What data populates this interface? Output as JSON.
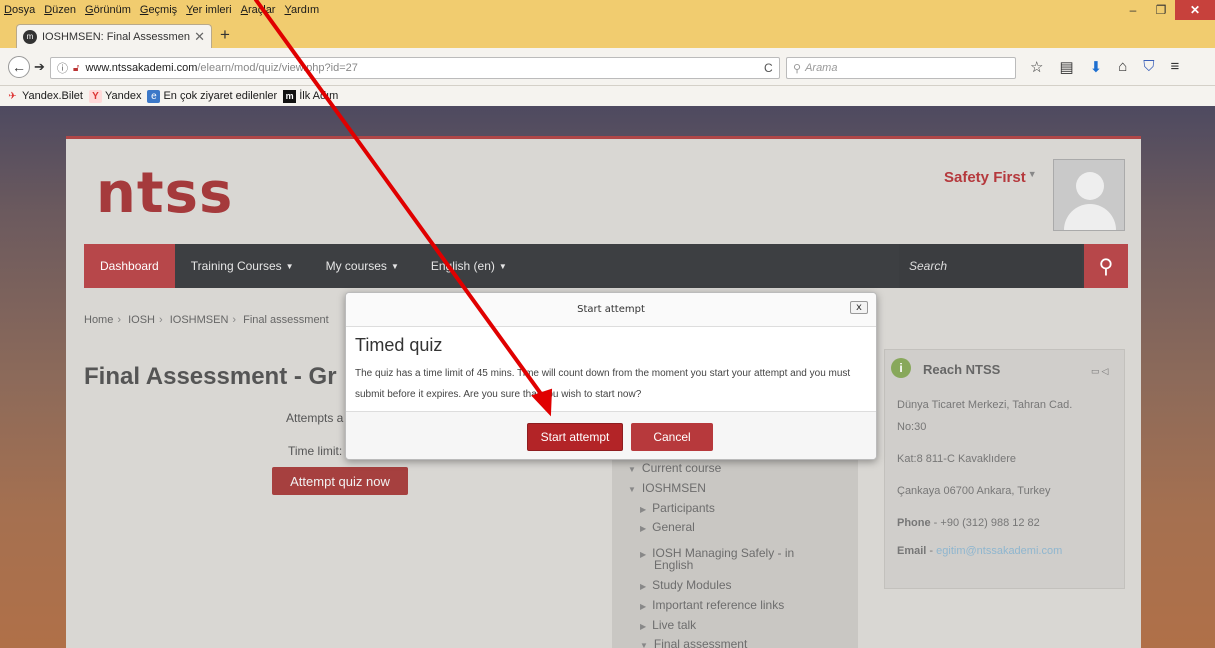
{
  "browser": {
    "menu": [
      "Dosya",
      "Düzen",
      "Görünüm",
      "Geçmiş",
      "Yer imleri",
      "Araçlar",
      "Yardım"
    ],
    "tab_title": "IOSHMSEN: Final Assessmen",
    "url_domain": "www.ntssakademi.com",
    "url_path": "/elearn/mod/quiz/view.php?id=27",
    "search_placeholder": "Arama",
    "bookmarks": [
      "Yandex.Bilet",
      "Yandex",
      "En çok ziyaret edilenler",
      "İlk Adım"
    ]
  },
  "site": {
    "logo": "ntss",
    "user_name": "Safety First",
    "nav": [
      "Dashboard",
      "Training Courses",
      "My courses",
      "English (en)"
    ],
    "search_placeholder": "Search",
    "breadcrumb": [
      "Home",
      "IOSH",
      "IOSHMSEN",
      "Final assessment"
    ],
    "page_title": "Final Assessment - Gr",
    "attempts_label": "Attempts a",
    "time_limit_label": "Time limit:",
    "attempt_button": "Attempt quiz now"
  },
  "navigation_tree": [
    {
      "label": "Current course",
      "arrow": "down"
    },
    {
      "label": "IOSHMSEN",
      "arrow": "down"
    },
    {
      "label": "Participants",
      "arrow": "right"
    },
    {
      "label": "General",
      "arrow": "right"
    },
    {
      "label": "IOSH Managing Safely - in",
      "arrow": "right"
    },
    {
      "label": "English",
      "arrow": ""
    },
    {
      "label": "Study Modules",
      "arrow": "right"
    },
    {
      "label": "Important reference links",
      "arrow": "right"
    },
    {
      "label": "Live talk",
      "arrow": "right"
    },
    {
      "label": "Final assessment",
      "arrow": "down"
    }
  ],
  "reach": {
    "title": "Reach NTSS",
    "address1": "Dünya Ticaret Merkezi, Tahran Cad.",
    "address2": "No:30",
    "address3": "Kat:8 811-C Kavaklıdere",
    "address4": "Çankaya 06700 Ankara, Turkey",
    "phone_label": "Phone",
    "phone": "+90 (312) 988 12 82",
    "email_label": "Email",
    "email": "egitim@ntssakademi.com"
  },
  "modal": {
    "header": "Start attempt",
    "close": "x",
    "heading": "Timed quiz",
    "text": "The quiz has a time limit of 45 mins. Time will count down from the moment you start your attempt and you must submit before it expires. Are you sure that you wish to start now?",
    "start_button": "Start attempt",
    "cancel_button": "Cancel"
  },
  "colors": {
    "brand": "#a53a3c",
    "nav_bg": "#3d3f42",
    "annotation": "#e00000"
  }
}
